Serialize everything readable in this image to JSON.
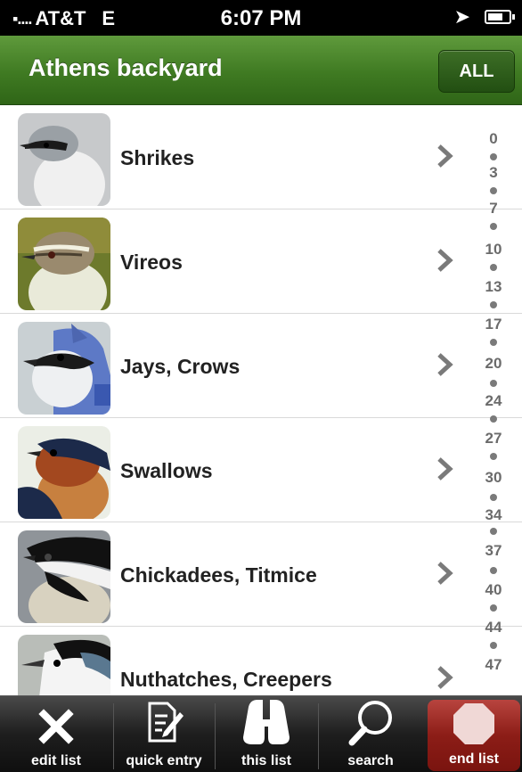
{
  "status": {
    "carrier": "AT&T",
    "network": "E",
    "time": "6:07 PM"
  },
  "nav": {
    "title": "Athens backyard",
    "all_label": "ALL"
  },
  "list": [
    {
      "label": "Shrikes",
      "icon": "shrike-thumbnail"
    },
    {
      "label": "Vireos",
      "icon": "vireo-thumbnail"
    },
    {
      "label": "Jays, Crows",
      "icon": "blue-jay-thumbnail"
    },
    {
      "label": "Swallows",
      "icon": "swallow-thumbnail"
    },
    {
      "label": "Chickadees, Titmice",
      "icon": "chickadee-thumbnail"
    },
    {
      "label": "Nuthatches, Creepers",
      "icon": "nuthatch-thumbnail"
    }
  ],
  "index": [
    "0",
    "3",
    "7",
    "10",
    "13",
    "17",
    "20",
    "24",
    "27",
    "30",
    "34",
    "37",
    "40",
    "44",
    "47"
  ],
  "toolbar": {
    "edit": "edit list",
    "quick": "quick entry",
    "this_list": "this list",
    "search": "search",
    "end": "end list"
  },
  "colors": {
    "nav_green": "#3f7a22",
    "end_red": "#8c1d17",
    "toolbar_dark": "#1e1e1e"
  }
}
